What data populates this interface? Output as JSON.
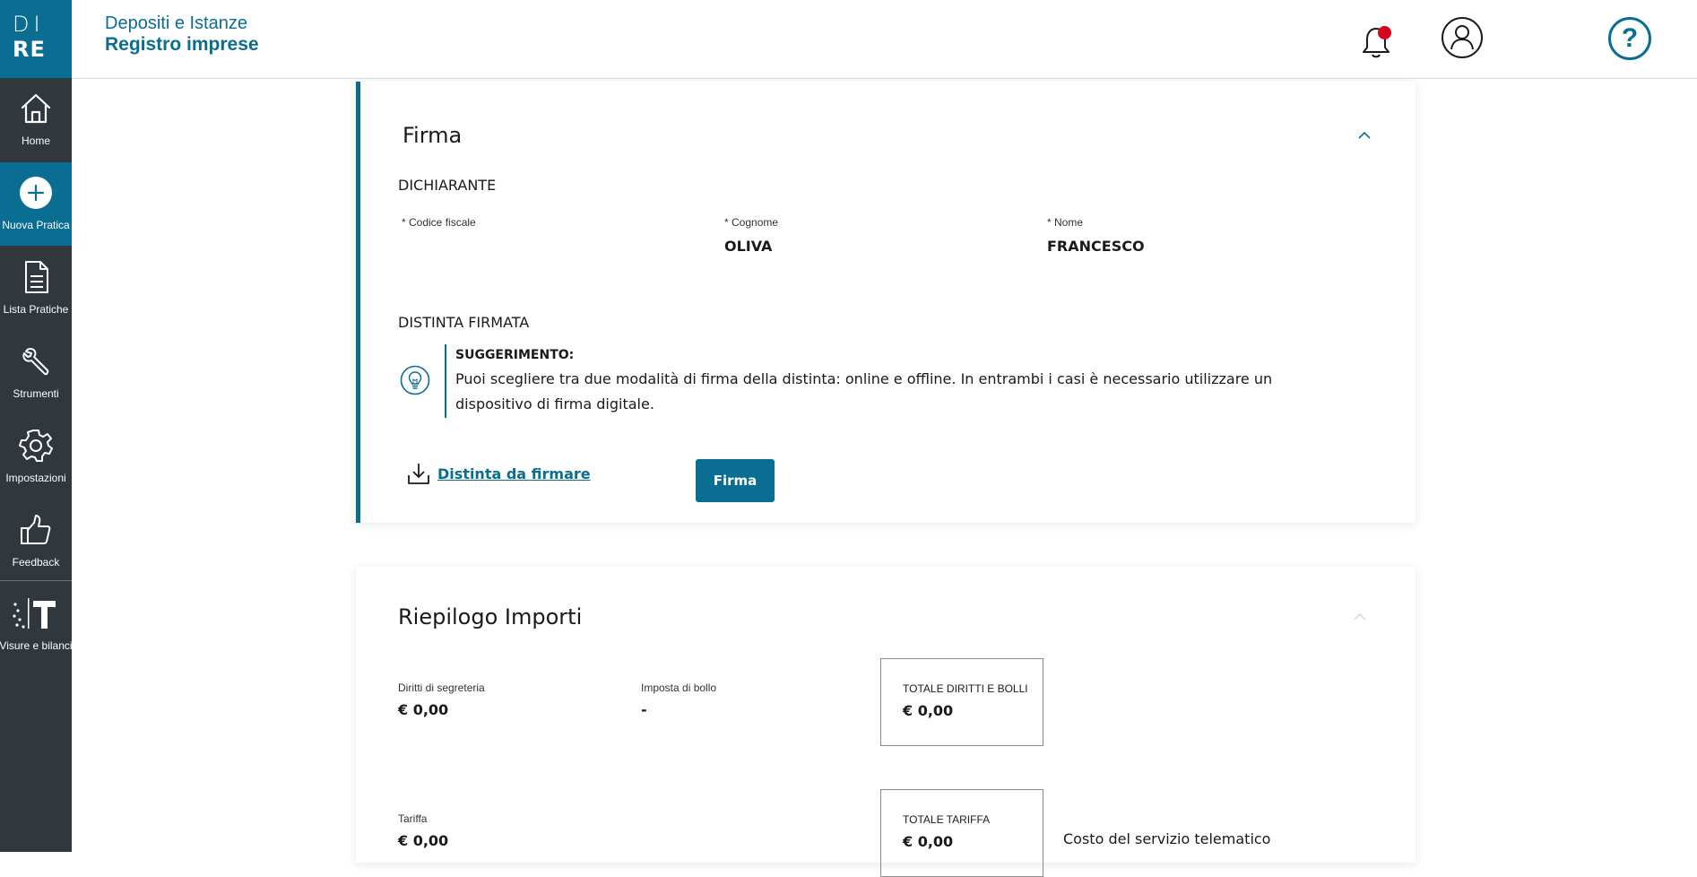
{
  "logo": {
    "line1": "DI",
    "line2": "RE"
  },
  "sidebar": {
    "items": [
      {
        "label": "Home",
        "icon": "home-icon"
      },
      {
        "label": "Nuova Pratica",
        "icon": "plus-circle-icon",
        "active": true
      },
      {
        "label": "Lista Pratiche",
        "icon": "document-icon"
      },
      {
        "label": "Strumenti",
        "icon": "wrench-icon"
      },
      {
        "label": "Impostazioni",
        "icon": "gear-icon"
      },
      {
        "label": "Feedback",
        "icon": "thumbs-up-icon"
      },
      {
        "label": "Visure e bilanci",
        "icon": "telemaco-icon"
      }
    ]
  },
  "header": {
    "subtitle": "Depositi e Istanze",
    "title": "Registro imprese",
    "help_label": "?",
    "notification_icon": "bell-icon",
    "user_icon": "user-icon"
  },
  "firma": {
    "title": "Firma",
    "dichiarante_label": "DICHIARANTE",
    "fields": {
      "codice_fiscale": {
        "label": "* Codice fiscale",
        "value": ""
      },
      "cognome": {
        "label": "* Cognome",
        "value": "OLIVA"
      },
      "nome": {
        "label": "* Nome",
        "value": "FRANCESCO"
      }
    },
    "distinta_label": "DISTINTA FIRMATA",
    "tip": {
      "title": "SUGGERIMENTO:",
      "text": "Puoi scegliere tra due modalità di firma della distinta: online e offline. In entrambi i casi è necessario utilizzare un dispositivo di firma digitale."
    },
    "download_label": "Distinta da firmare",
    "button_label": "Firma"
  },
  "riepilogo": {
    "title": "Riepilogo Importi",
    "diritti": {
      "label": "Diritti di segreteria",
      "value": "€ 0,00"
    },
    "bollo": {
      "label": "Imposta di bollo",
      "value": "-"
    },
    "totale_diritti": {
      "label": "TOTALE DIRITTI E BOLLI",
      "value": "€ 0,00"
    },
    "tariffa": {
      "label": "Tariffa",
      "value": "€ 0,00"
    },
    "totale_tariffa": {
      "label": "TOTALE TARIFFA",
      "value": "€ 0,00"
    },
    "costo_label": "Costo del servizio telematico"
  },
  "colors": {
    "primary": "#0a6d92",
    "sidebar": "#30373d",
    "alert": "#d6001c"
  }
}
